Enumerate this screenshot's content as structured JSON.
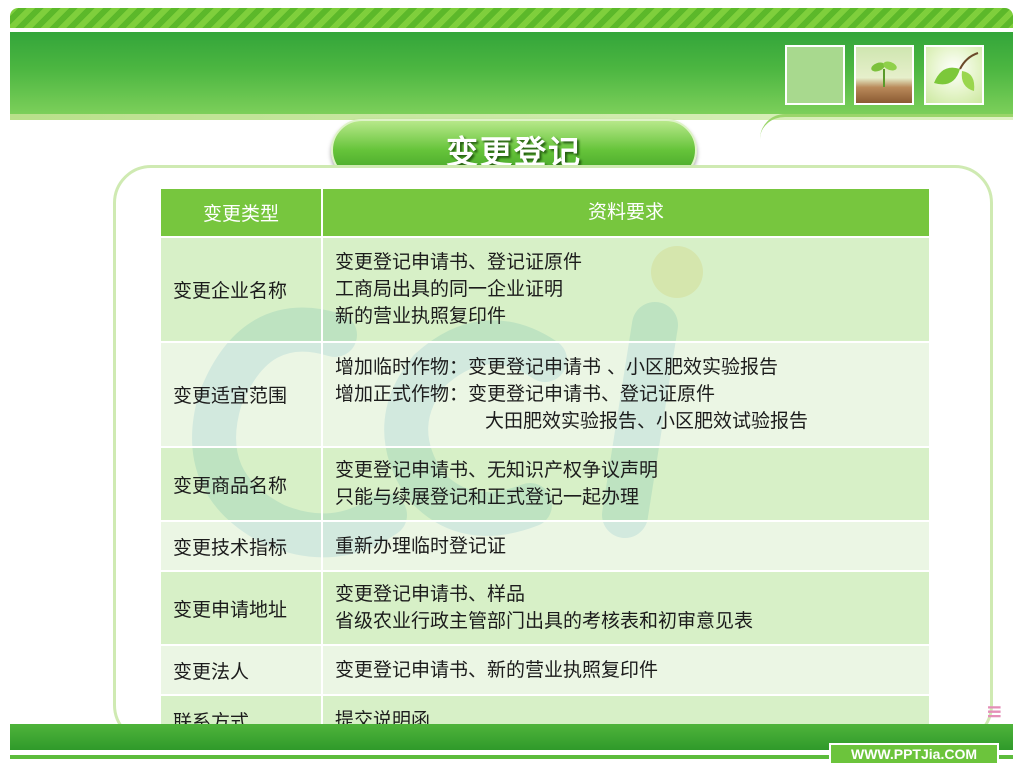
{
  "title": "变更登记",
  "footer": "WWW.PPTJia.COM",
  "table": {
    "headers": [
      "变更类型",
      "资料要求"
    ],
    "rows": [
      {
        "type": "变更企业名称",
        "lines": [
          "变更登记申请书、登记证原件",
          "工商局出具的同一企业证明",
          "新的营业执照复印件"
        ]
      },
      {
        "type": "变更适宜范围",
        "lines": [
          "增加临时作物：变更登记申请书 、小区肥效实验报告",
          "增加正式作物：变更登记申请书、登记证原件",
          "大田肥效实验报告、小区肥效试验报告"
        ]
      },
      {
        "type": "变更商品名称",
        "lines": [
          "变更登记申请书、无知识产权争议声明",
          "只能与续展登记和正式登记一起办理"
        ]
      },
      {
        "type": "变更技术指标",
        "lines": [
          "重新办理临时登记证"
        ]
      },
      {
        "type": "变更申请地址",
        "lines": [
          "变更登记申请书、样品",
          "省级农业行政主管部门出具的考核表和初审意见表"
        ]
      },
      {
        "type": "变更法人",
        "lines": [
          "变更登记申请书、新的营业执照复印件"
        ]
      },
      {
        "type": "联系方式",
        "lines": [
          "提交说明函"
        ]
      }
    ]
  },
  "colors": {
    "header_bg": "#77c63e",
    "row_light": "#e6f4dc",
    "row_dark": "#ccecb7",
    "banner_green": "#33a53a",
    "watermark_blue": "#2f8fd0",
    "watermark_yellow": "#f2b648"
  },
  "icons": [
    "sprout-icon",
    "leaf-icon",
    "cci-logo-icon"
  ]
}
